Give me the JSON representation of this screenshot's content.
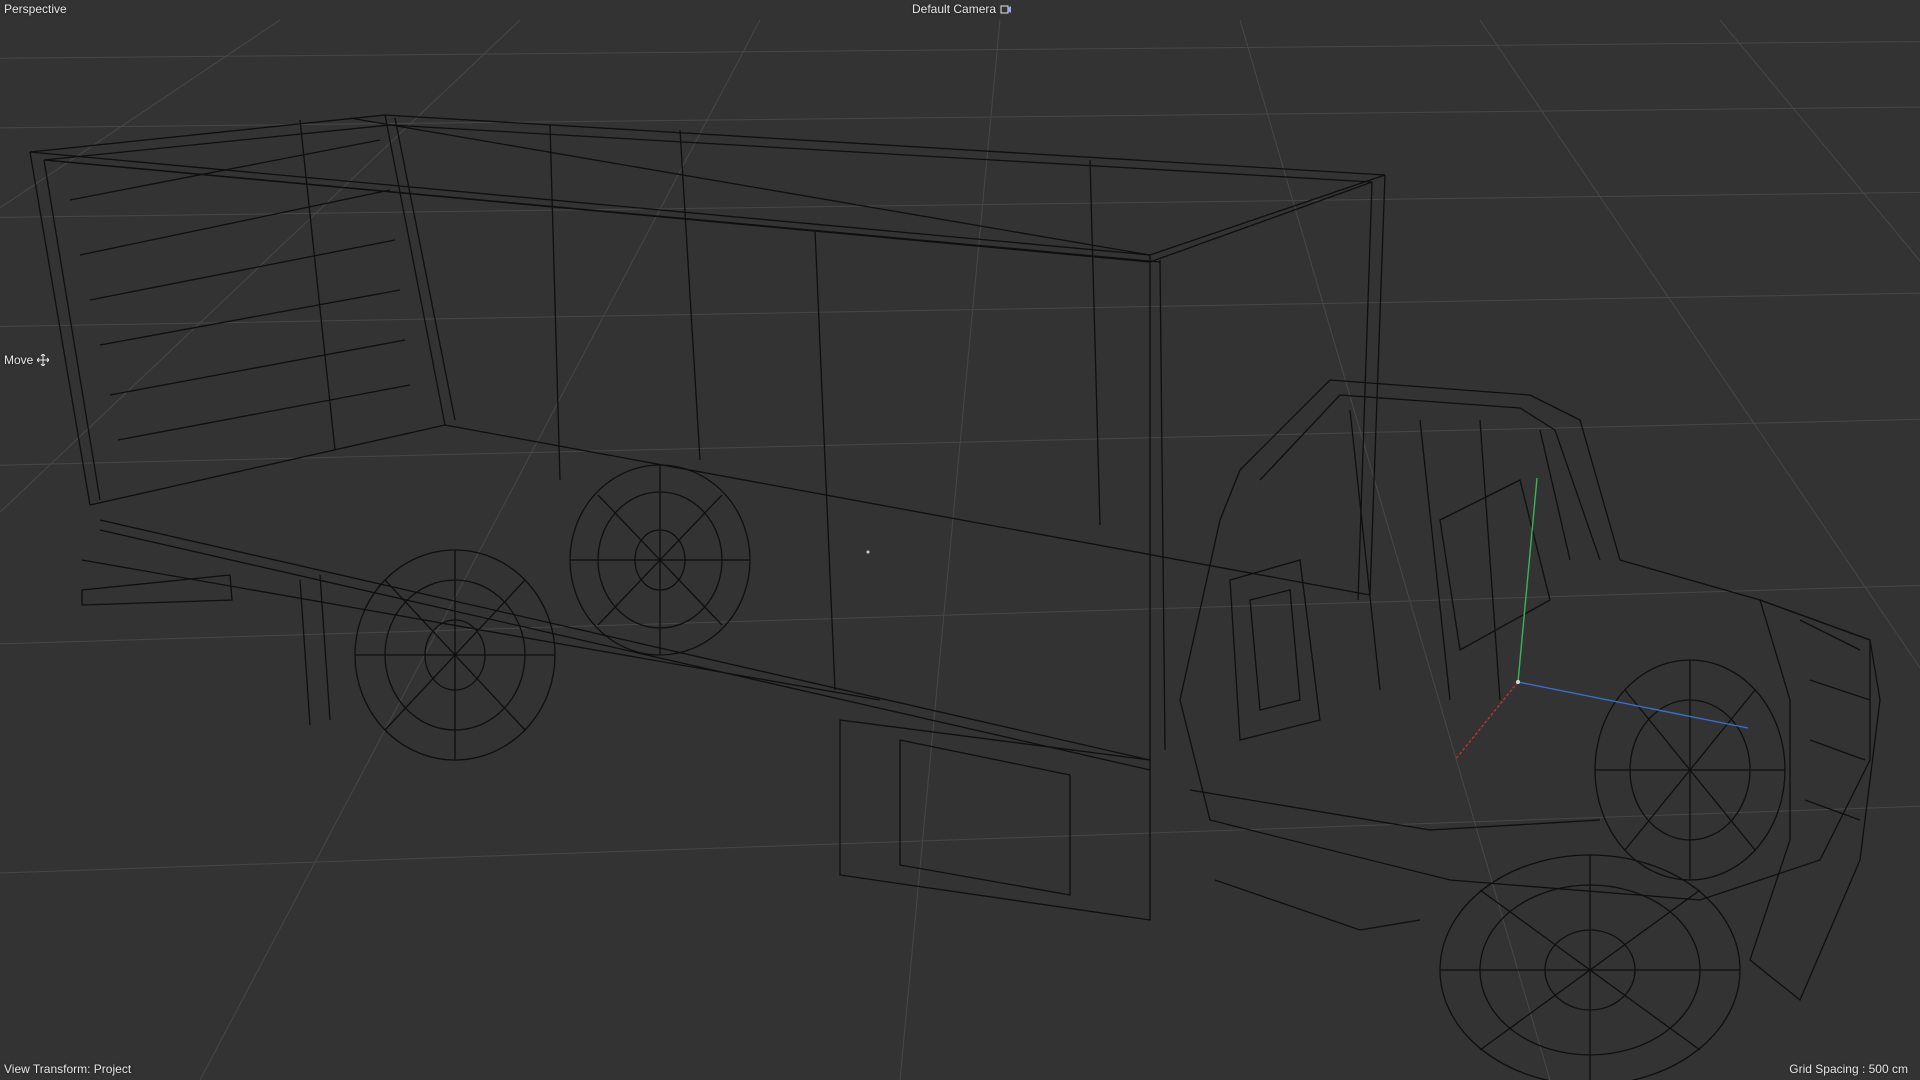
{
  "viewport": {
    "view_name": "Perspective",
    "camera_label": "Default Camera",
    "camera_icon": "camera-icon",
    "tool_label": "Move",
    "tool_icon": "move-icon",
    "view_transform": "View Transform: Project",
    "grid_spacing": "Grid Spacing : 500 cm"
  },
  "colors": {
    "background": "#333333",
    "grid_line": "#4a4a4a",
    "wireframe": "#0f0f0f",
    "hud_text": "#e6e6e6",
    "axis_x": "#b83232",
    "axis_y": "#39b35a",
    "axis_z": "#3a6fd0"
  },
  "scene": {
    "object": "box truck wireframe"
  }
}
